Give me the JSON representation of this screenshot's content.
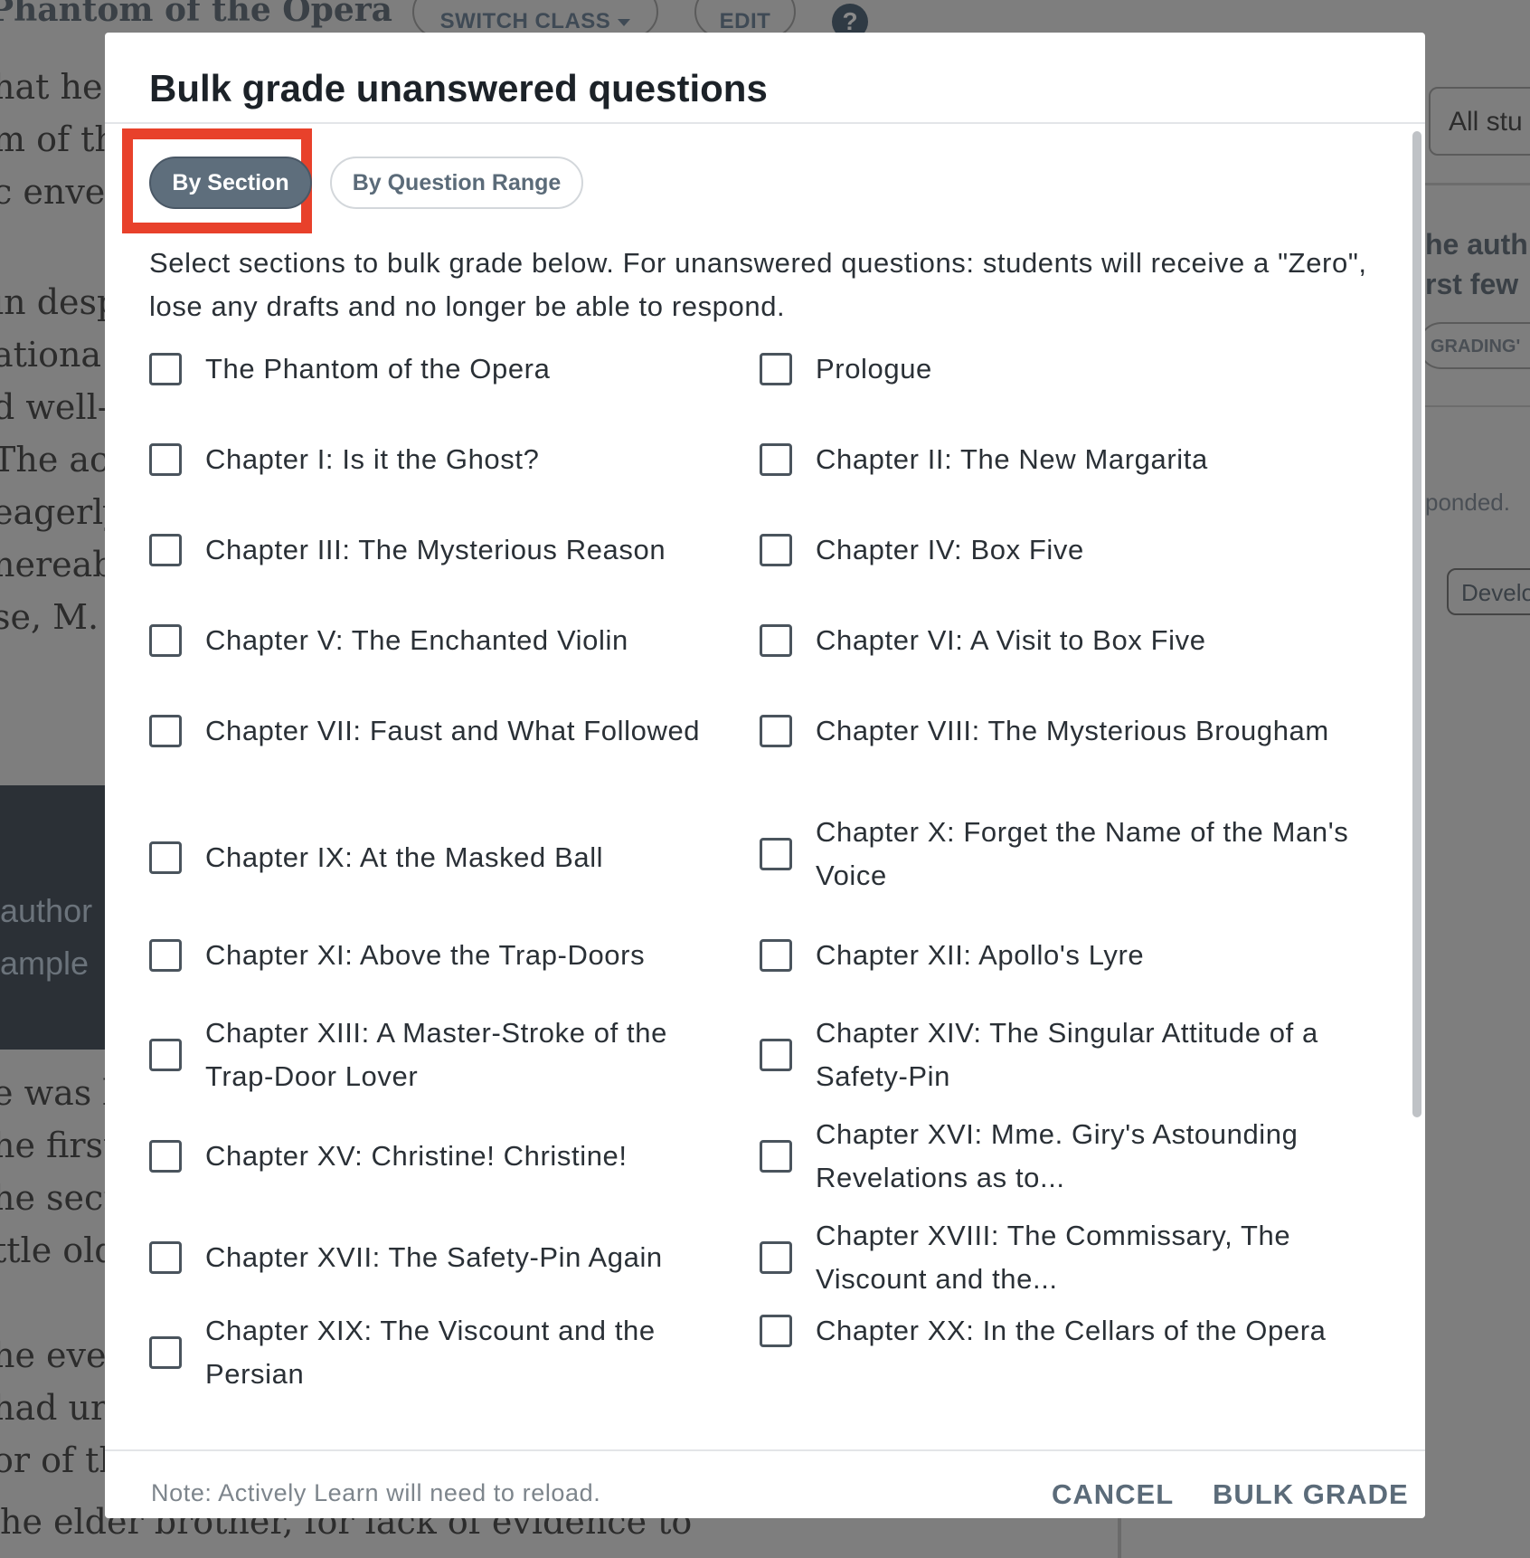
{
  "background": {
    "book_title": "Phantom of the Opera",
    "switch_class_label": "SWITCH CLASS",
    "edit_label": "EDIT",
    "help_label": "?",
    "reading_lines_left": [
      "hat he c",
      "m of the",
      "c enve",
      "",
      "in desp",
      "ationa",
      "d well-",
      "The act",
      "eagerly",
      "nereabo",
      "se, M. I"
    ],
    "dark_block_lines": [
      "author",
      "ample"
    ],
    "reading_lines_lower": [
      "e was b",
      "he first",
      "he secr",
      "ttle old",
      "",
      "he ever",
      " had ur",
      "or of th"
    ],
    "bottom_line": "he elder brother, for lack of evidence to",
    "right_panel": {
      "students_select": "All stu",
      "text_1": "he auth",
      "text_2": "rst few",
      "grading_badge": "GRADING'",
      "responded_text": "ponded.",
      "develop_button": "Develo"
    }
  },
  "modal": {
    "title": "Bulk grade unanswered questions",
    "tabs": [
      {
        "label": "By Section",
        "active": true
      },
      {
        "label": "By Question Range",
        "active": false
      }
    ],
    "instructions": "Select sections to bulk grade below. For unanswered questions: students will receive a \"Zero\", lose any drafts and no longer be able to respond.",
    "sections_left": [
      "The Phantom of the Opera",
      "Chapter I: Is it the Ghost?",
      "Chapter III: The Mysterious Reason",
      "Chapter V: The Enchanted Violin",
      "Chapter VII: Faust and What Followed",
      "Chapter IX: At the Masked Ball",
      "Chapter XI: Above the Trap-Doors",
      "Chapter XIII: A Master-Stroke of the Trap-Door Lover",
      "Chapter XV: Christine! Christine!",
      "Chapter XVII: The Safety-Pin Again",
      "Chapter XIX: The Viscount and the Persian"
    ],
    "sections_right": [
      "Prologue",
      "Chapter II: The New Margarita",
      "Chapter IV: Box Five",
      "Chapter VI: A Visit to Box Five",
      "Chapter VIII: The Mysterious Brougham",
      "Chapter X: Forget the Name of the Man's Voice",
      "Chapter XII: Apollo's Lyre",
      "Chapter XIV: The Singular Attitude of a Safety-Pin",
      "Chapter XVI: Mme. Giry's Astounding Revelations as to...",
      "Chapter XVIII: The Commissary, The Viscount and the...",
      "Chapter XX: In the Cellars of the Opera"
    ],
    "footer_note": "Note: Actively Learn will need to reload.",
    "cancel_label": "CANCEL",
    "bulk_grade_label": "BULK GRADE"
  },
  "colors": {
    "overlay": "#7e7e7e",
    "active_tab": "#5e6e7c",
    "highlight": "#e8412b",
    "button_text": "#5b6b79"
  }
}
